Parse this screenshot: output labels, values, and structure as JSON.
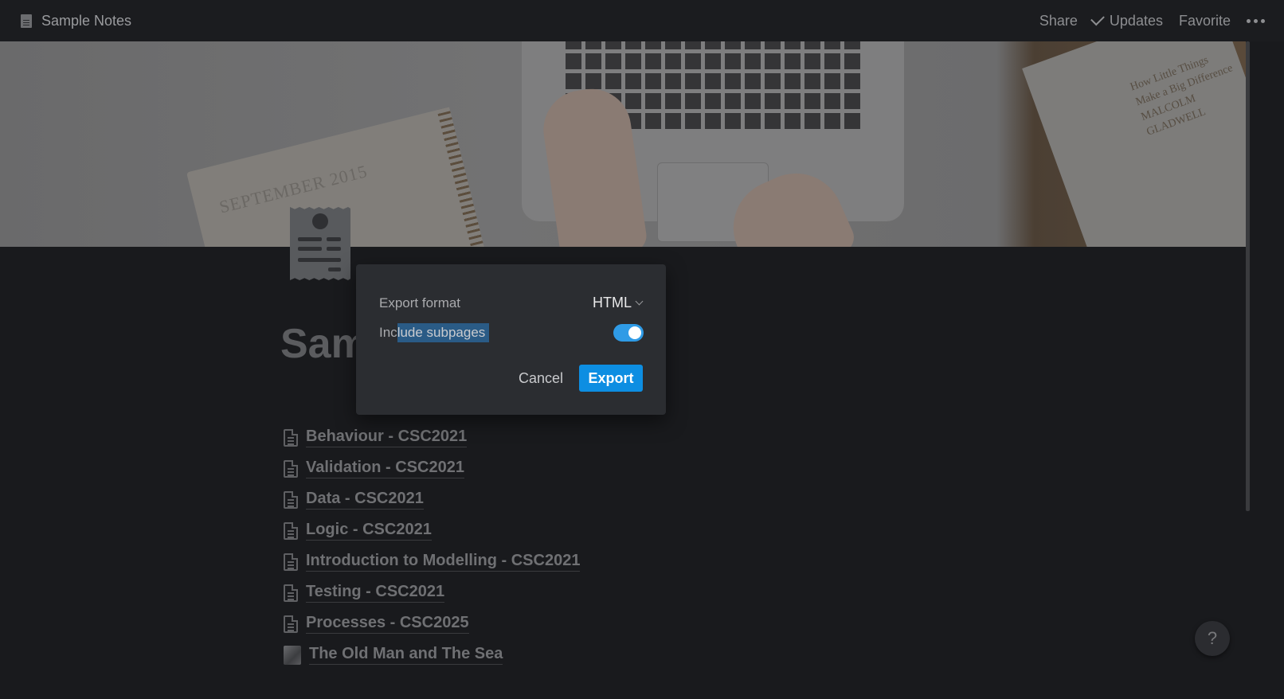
{
  "topbar": {
    "breadcrumb": "Sample Notes",
    "share_label": "Share",
    "updates_label": "Updates",
    "favorite_label": "Favorite"
  },
  "cover": {
    "notebook_text": "SEPTEMBER 2015",
    "book_text": [
      "How Little Things",
      "Make a Big Difference",
      "MALCOLM",
      "GLADWELL"
    ]
  },
  "page": {
    "title_partial": "Sam"
  },
  "subpages": [
    {
      "label": "Behaviour - CSC2021",
      "icon": "document-icon"
    },
    {
      "label": "Validation - CSC2021",
      "icon": "document-icon"
    },
    {
      "label": "Data - CSC2021",
      "icon": "document-icon"
    },
    {
      "label": "Logic - CSC2021",
      "icon": "document-icon"
    },
    {
      "label": "Introduction to Modelling - CSC2021",
      "icon": "document-icon"
    },
    {
      "label": "Testing - CSC2021",
      "icon": "document-icon"
    },
    {
      "label": "Processes - CSC2025",
      "icon": "document-icon"
    },
    {
      "label": "The Old Man and The Sea",
      "icon": "image-icon"
    }
  ],
  "export_dialog": {
    "format_label": "Export format",
    "format_value": "HTML",
    "subpages_label_plain": "Inc",
    "subpages_label_selected": "lude subpages",
    "include_subpages": true,
    "cancel_label": "Cancel",
    "export_label": "Export"
  },
  "help_label": "?",
  "colors": {
    "background": "#191a1d",
    "dialog": "#2b2d31",
    "accent": "#0d8ee2",
    "toggle_on": "#2f9be6",
    "selection": "#2a5b86"
  }
}
